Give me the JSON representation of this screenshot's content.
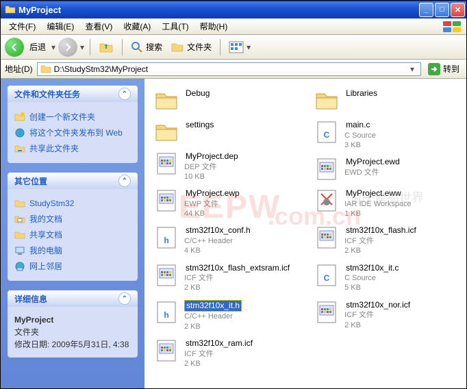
{
  "window": {
    "title": "MyProject"
  },
  "menu": {
    "file": "文件(F)",
    "edit": "编辑(E)",
    "view": "查看(V)",
    "favorites": "收藏(A)",
    "tools": "工具(T)",
    "help": "帮助(H)"
  },
  "toolbar": {
    "back": "后退",
    "search": "搜索",
    "folders": "文件夹"
  },
  "addressbar": {
    "label": "地址(D)",
    "path": "D:\\StudyStm32\\MyProject",
    "go": "转到"
  },
  "sidebar": {
    "tasks": {
      "title": "文件和文件夹任务",
      "items": [
        "创建一个新文件夹",
        "将这个文件夹发布到 Web",
        "共享此文件夹"
      ]
    },
    "places": {
      "title": "其它位置",
      "items": [
        "StudyStm32",
        "我的文档",
        "共享文档",
        "我的电脑",
        "网上邻居"
      ]
    },
    "details": {
      "title": "详细信息",
      "name": "MyProject",
      "type": "文件夹",
      "modified_label": "修改日期: 2009年5月31日, 4:38"
    }
  },
  "files": {
    "col1": [
      {
        "name": "Debug",
        "kind": "folder"
      },
      {
        "name": "settings",
        "kind": "folder"
      },
      {
        "name": "MyProject.dep",
        "kind": "dep",
        "type": "DEP 文件",
        "size": "10 KB"
      },
      {
        "name": "MyProject.ewp",
        "kind": "ewp",
        "type": "EWP 文件",
        "size": "44 KB"
      },
      {
        "name": "stm32f10x_conf.h",
        "kind": "h",
        "type": "C/C++ Header",
        "size": "4 KB"
      },
      {
        "name": "stm32f10x_flash_extsram.icf",
        "kind": "icf",
        "type": "ICF 文件",
        "size": "2 KB"
      },
      {
        "name": "stm32f10x_it.h",
        "kind": "h",
        "type": "C/C++ Header",
        "size": "2 KB",
        "selected": true
      },
      {
        "name": "stm32f10x_ram.icf",
        "kind": "icf",
        "type": "ICF 文件",
        "size": "2 KB"
      }
    ],
    "col2": [
      {
        "name": "Libraries",
        "kind": "folder"
      },
      {
        "name": "main.c",
        "kind": "c",
        "type": "C Source",
        "size": "3 KB"
      },
      {
        "name": "MyProject.ewd",
        "kind": "ewd",
        "type": "EWD 文件"
      },
      {
        "name": "MyProject.eww",
        "kind": "eww",
        "type": "IAR IDE Workspace",
        "size": "1 KB"
      },
      {
        "name": "stm32f10x_flash.icf",
        "kind": "icf",
        "type": "ICF 文件",
        "size": "2 KB"
      },
      {
        "name": "stm32f10x_it.c",
        "kind": "c",
        "type": "C Source",
        "size": "5 KB"
      },
      {
        "name": "stm32f10x_nor.icf",
        "kind": "icf",
        "type": "ICF 文件",
        "size": "2 KB"
      }
    ]
  }
}
